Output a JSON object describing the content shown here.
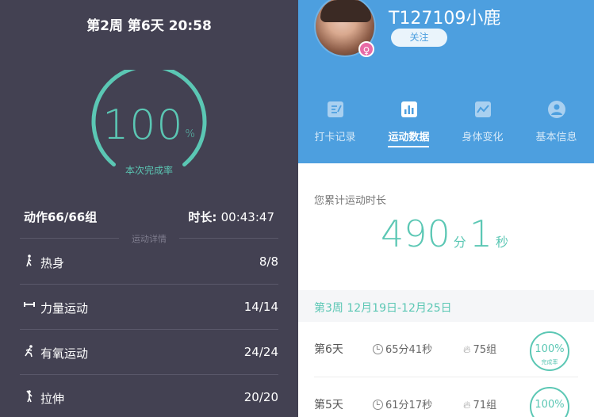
{
  "left": {
    "header": "第2周 第6天 20:58",
    "completion_percent": "100",
    "completion_sign": "%",
    "completion_label": "本次完成率",
    "actions_text": "动作66/66组",
    "duration_label": "时长: ",
    "duration_value": "00:43:47",
    "detail_title": "运动详情",
    "exercises": [
      {
        "label": "热身",
        "value": "8/8",
        "icon": "warmup-icon"
      },
      {
        "label": "力量运动",
        "value": "14/14",
        "icon": "dumbbell-icon"
      },
      {
        "label": "有氧运动",
        "value": "24/24",
        "icon": "running-icon"
      },
      {
        "label": "拉伸",
        "value": "20/20",
        "icon": "stretch-icon"
      }
    ],
    "colors": {
      "accent": "#5bc7b4",
      "background": "#434152"
    }
  },
  "right": {
    "username": "T127109小鹿",
    "follow_label": "关注",
    "gender_symbol": "♀",
    "tabs": [
      {
        "label": "打卡记录",
        "icon": "checkin-icon",
        "active": false
      },
      {
        "label": "运动数据",
        "icon": "bar-chart-icon",
        "active": true
      },
      {
        "label": "身体变化",
        "icon": "trend-icon",
        "active": false
      },
      {
        "label": "基本信息",
        "icon": "profile-icon",
        "active": false
      }
    ],
    "total_label": "您累计运动时长",
    "total_minutes": "490",
    "minutes_unit": "分",
    "total_seconds": "1",
    "seconds_unit": "秒",
    "week_title": "第3周 12月19日-12月25日",
    "days": [
      {
        "day": "第6天",
        "time": "65分41秒",
        "sets": "75组",
        "pct": "100%",
        "pct_label": "完成率"
      },
      {
        "day": "第5天",
        "time": "61分17秒",
        "sets": "71组",
        "pct": "100%",
        "pct_label": ""
      }
    ],
    "colors": {
      "header_blue": "#4d9fdf",
      "accent": "#5bc7b4"
    }
  }
}
